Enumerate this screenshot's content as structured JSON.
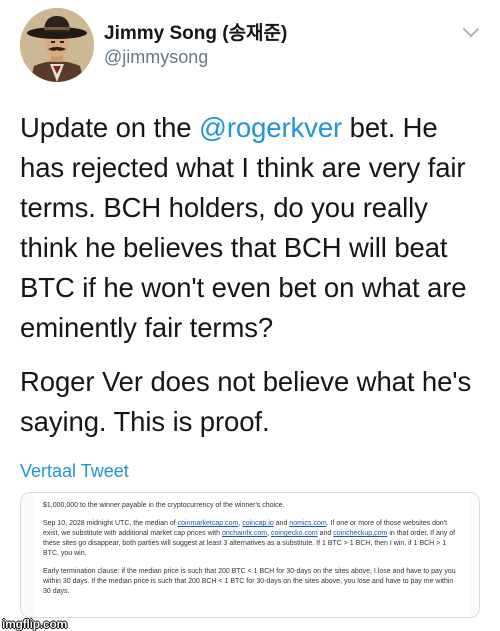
{
  "author": {
    "display_name": "Jimmy Song (송재준)",
    "handle": "@jimmysong",
    "avatar_icon": "cowboy-avatar-icon"
  },
  "tweet": {
    "text_before_mention": "Update on the ",
    "mention": "@rogerkver",
    "text_after_mention": " bet. He has rejected what I think are very fair terms. BCH holders, do you really think he believes that BCH will beat BTC if he won't even bet on what are eminently fair terms?",
    "paragraph2": "Roger Ver does not believe what he's saying. This is proof."
  },
  "translate_link": "Vertaal Tweet",
  "attachment": {
    "line1": "$1,000,000 to the winner payable in the cryptocurrency of the winner's choice.",
    "p2_a": "Sep 10, 2028 midnight UTC, the median of ",
    "p2_link1": "coinmarketcap.com",
    "p2_sep1": ", ",
    "p2_link2": "coincap.io",
    "p2_and": " and ",
    "p2_link3": "nomics.com",
    "p2_b": ". If one or more of those websites don't exist, we substitute with additional market cap prices with ",
    "p2_link4": "onchainfx.com",
    "p2_sep2": ", ",
    "p2_link5": "coingecko.com",
    "p2_and2": " and ",
    "p2_link6": "coincheckup.com",
    "p2_c": " in that order. If any of these sites go disappear, both parties will suggest at least 3 alternatives as a substitute. If 1 BTC > 1 BCH, then I win, if 1 BCH > 1 BTC, you win.",
    "p3": "Early termination clause: if the median price is such that 200 BTC < 1 BCH for 30-days on the sites above, I lose and have to pay you within 30 days.  If the median price is such that 200 BCH < 1 BTC for 30-days on the sites above, you lose and have to pay me within 30 days."
  },
  "watermark": "imgflip.com",
  "colors": {
    "link_blue": "#1b95e0",
    "text": "#14171a",
    "secondary": "#657786"
  }
}
